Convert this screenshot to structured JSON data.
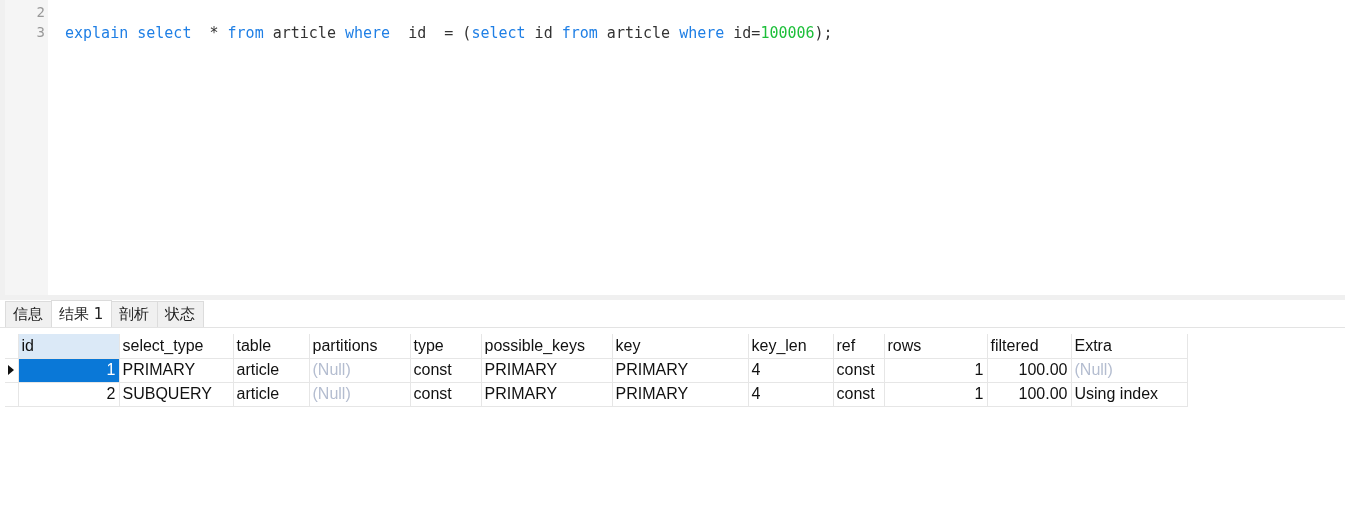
{
  "editor": {
    "lines": [
      {
        "number": "2"
      },
      {
        "number": "3",
        "tokens": [
          {
            "kind": "keyword",
            "text": "explain select"
          },
          {
            "kind": "plain",
            "text": "  * "
          },
          {
            "kind": "keyword",
            "text": "from"
          },
          {
            "kind": "plain",
            "text": " article "
          },
          {
            "kind": "keyword",
            "text": "where"
          },
          {
            "kind": "plain",
            "text": "  id  = ("
          },
          {
            "kind": "keyword",
            "text": "select"
          },
          {
            "kind": "plain",
            "text": " id "
          },
          {
            "kind": "keyword",
            "text": "from"
          },
          {
            "kind": "plain",
            "text": " article "
          },
          {
            "kind": "keyword",
            "text": "where"
          },
          {
            "kind": "plain",
            "text": " id="
          },
          {
            "kind": "number",
            "text": "100006"
          },
          {
            "kind": "plain",
            "text": ");"
          }
        ]
      }
    ]
  },
  "tabs": [
    {
      "label": "信息",
      "selected": false
    },
    {
      "label": "结果 1",
      "selected": true
    },
    {
      "label": "剖析",
      "selected": false
    },
    {
      "label": "状态",
      "selected": false
    }
  ],
  "table": {
    "columns": [
      {
        "label": "id",
        "kind": "numeric"
      },
      {
        "label": "select_type",
        "kind": "text"
      },
      {
        "label": "table",
        "kind": "text"
      },
      {
        "label": "partitions",
        "kind": "text"
      },
      {
        "label": "type",
        "kind": "text"
      },
      {
        "label": "possible_keys",
        "kind": "text"
      },
      {
        "label": "key",
        "kind": "text"
      },
      {
        "label": "key_len",
        "kind": "text"
      },
      {
        "label": "ref",
        "kind": "text"
      },
      {
        "label": "rows",
        "kind": "numeric"
      },
      {
        "label": "filtered",
        "kind": "numeric"
      },
      {
        "label": "Extra",
        "kind": "text"
      }
    ],
    "rows": [
      {
        "selected": true,
        "cells": [
          {
            "text": "1",
            "null": false
          },
          {
            "text": "PRIMARY",
            "null": false
          },
          {
            "text": "article",
            "null": false
          },
          {
            "text": "(Null)",
            "null": true
          },
          {
            "text": "const",
            "null": false
          },
          {
            "text": "PRIMARY",
            "null": false
          },
          {
            "text": "PRIMARY",
            "null": false
          },
          {
            "text": "4",
            "null": false
          },
          {
            "text": "const",
            "null": false
          },
          {
            "text": "1",
            "null": false
          },
          {
            "text": "100.00",
            "null": false
          },
          {
            "text": "(Null)",
            "null": true
          }
        ]
      },
      {
        "selected": false,
        "cells": [
          {
            "text": "2",
            "null": false
          },
          {
            "text": "SUBQUERY",
            "null": false
          },
          {
            "text": "article",
            "null": false
          },
          {
            "text": "(Null)",
            "null": true
          },
          {
            "text": "const",
            "null": false
          },
          {
            "text": "PRIMARY",
            "null": false
          },
          {
            "text": "PRIMARY",
            "null": false
          },
          {
            "text": "4",
            "null": false
          },
          {
            "text": "const",
            "null": false
          },
          {
            "text": "1",
            "null": false
          },
          {
            "text": "100.00",
            "null": false
          },
          {
            "text": "Using index",
            "null": false
          }
        ]
      }
    ]
  }
}
